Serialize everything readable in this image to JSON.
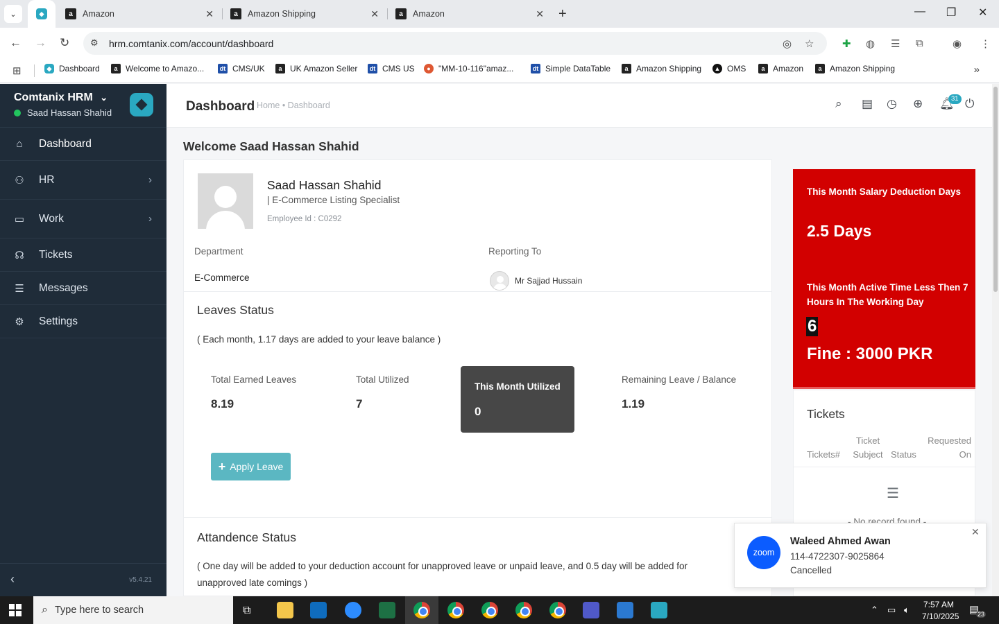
{
  "browser": {
    "tabs": [
      {
        "label": "Amazon"
      },
      {
        "label": "Amazon Shipping"
      },
      {
        "label": "Amazon"
      }
    ],
    "url": "hrm.comtanix.com/account/dashboard",
    "bookmarks": [
      {
        "label": "Dashboard",
        "icon": "hrm"
      },
      {
        "label": "Welcome to Amazo...",
        "icon": "amazon"
      },
      {
        "label": "CMS/UK",
        "icon": "dt"
      },
      {
        "label": "UK Amazon Seller",
        "icon": "amazon"
      },
      {
        "label": "CMS US",
        "icon": "dt"
      },
      {
        "label": "\"MM-10-116\"amaz...",
        "icon": "duckduckgo"
      },
      {
        "label": "Simple DataTable",
        "icon": "dt"
      },
      {
        "label": "Amazon Shipping",
        "icon": "amazon"
      },
      {
        "label": "OMS",
        "icon": "oms"
      },
      {
        "label": "Amazon",
        "icon": "amazon"
      },
      {
        "label": "Amazon Shipping",
        "icon": "amazon"
      }
    ]
  },
  "sidebar": {
    "app_name": "Comtanix HRM",
    "user_name": "Saad Hassan Shahid",
    "items": [
      {
        "label": "Dashboard",
        "icon": "home-icon"
      },
      {
        "label": "HR",
        "icon": "users-icon"
      },
      {
        "label": "Work",
        "icon": "briefcase-icon"
      },
      {
        "label": "Tickets",
        "icon": "headset-icon"
      },
      {
        "label": "Messages",
        "icon": "message-icon"
      },
      {
        "label": "Settings",
        "icon": "gear-icon"
      }
    ],
    "version": "v5.4.21"
  },
  "header": {
    "title": "Dashboard",
    "breadcrumb": "Home • Dashboard",
    "notification_count": "31"
  },
  "welcome": "Welcome Saad Hassan Shahid",
  "profile": {
    "name": "Saad Hassan Shahid",
    "role": "| E-Commerce Listing Specialist",
    "employee_id": "Employee Id : C0292",
    "department_label": "Department",
    "department": "E-Commerce",
    "reporting_label": "Reporting To",
    "reporting_to": "Mr Sajjad Hussain"
  },
  "leaves": {
    "title": "Leaves Status",
    "note": "( Each month, 1.17 days are added to your leave balance )",
    "total_earned_label": "Total Earned Leaves",
    "total_earned": "8.19",
    "total_utilized_label": "Total Utilized",
    "total_utilized": "7",
    "month_utilized_label": "This Month Utilized",
    "month_utilized": "0",
    "remaining_label": "Remaining Leave / Balance",
    "remaining": "1.19",
    "apply_label": "Apply Leave"
  },
  "attendance": {
    "title": "Attandence Status",
    "note": "( One day will be added to your deduction account for unapproved leave or unpaid leave, and 0.5 day will be added for unapproved late comings )"
  },
  "alert": {
    "salary_label": "This Month Salary Deduction Days",
    "salary_value": "2.5 Days",
    "active_label": "This Month Active Time Less Then 7 Hours In The Working Day",
    "active_value": "6",
    "fine": "Fine : 3000 PKR",
    "color": "#d20000"
  },
  "tickets": {
    "title": "Tickets",
    "columns": [
      "Tickets#",
      "Ticket Subject",
      "Status",
      "Requested On"
    ],
    "empty": "- No record found -"
  },
  "zoom": {
    "logo": "zoom",
    "name": "Waleed Ahmed Awan",
    "number": "114-4722307-9025864",
    "status": "Cancelled"
  },
  "taskbar": {
    "search_placeholder": "Type here to search",
    "time": "7:57 AM",
    "date": "7/10/2025",
    "notifications": "23"
  }
}
